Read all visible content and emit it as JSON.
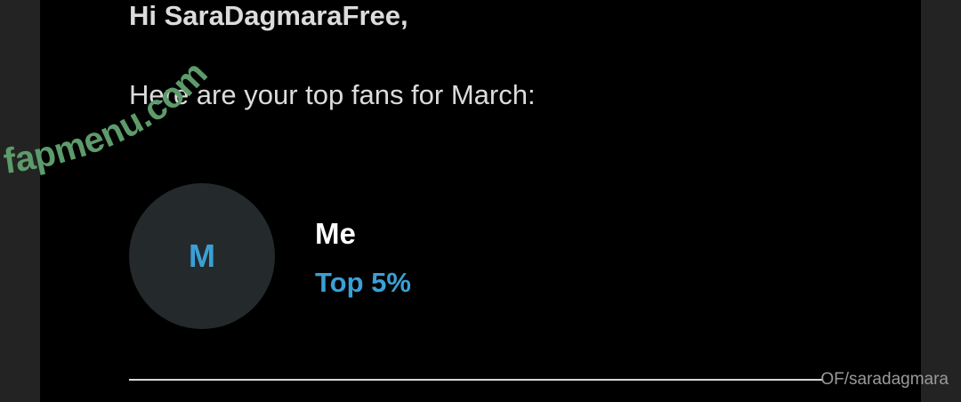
{
  "email": {
    "greeting": "Hi SaraDagmaraFree,",
    "intro": "Here are your top fans for March:",
    "fans": [
      {
        "initial": "M",
        "name": "Me",
        "rank": "Top 5%"
      }
    ]
  },
  "watermarks": {
    "logo_text": "fapmenu.com",
    "credit": "OF/saradagmara"
  },
  "colors": {
    "page_bg": "#232323",
    "panel_bg": "#000000",
    "text": "#dcdcdc",
    "accent": "#3aa0d6",
    "avatar_bg": "#242a2b",
    "logo_green": "#5d9b6b"
  }
}
